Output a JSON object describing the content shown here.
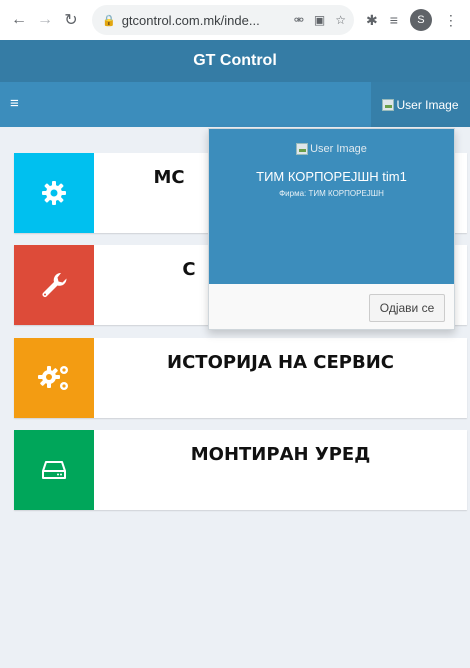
{
  "browser": {
    "url": "gtcontrol.com.mk/inde...",
    "profile_initial": "S"
  },
  "header": {
    "title": "GT Control",
    "user_image_alt": "User Image"
  },
  "cards": [
    {
      "title": "МОНТАЖА",
      "visible_title": "МС",
      "icon": "gear-icon",
      "color": "#00c0ef"
    },
    {
      "title": "СЕРВИС",
      "visible_title": "С",
      "icon": "wrench-icon",
      "color": "#dd4b39"
    },
    {
      "title": "ИСТОРИЈА НА СЕРВИС",
      "icon": "gears-icon",
      "color": "#f39c12"
    },
    {
      "title": "МОНТИРАН УРЕД",
      "icon": "hdd-icon",
      "color": "#00a65a"
    }
  ],
  "user_menu": {
    "image_alt": "User Image",
    "name": "ТИМ КОРПОРЕЈШН tim1",
    "company": "Фирма: ТИМ КОРПОРЕЈШН",
    "signout_label": "Одјави се"
  },
  "colors": {
    "header_dark": "#357ca5",
    "header": "#3c8dbc",
    "background": "#ecf0f5"
  }
}
